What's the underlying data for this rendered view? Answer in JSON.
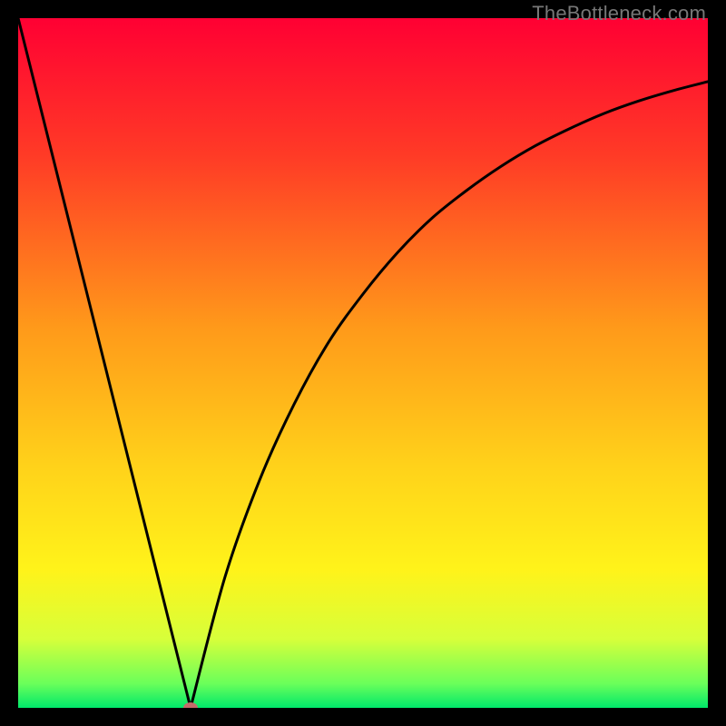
{
  "watermark": {
    "text": "TheBottleneck.com"
  },
  "chart_data": {
    "type": "line",
    "title": "",
    "xlabel": "",
    "ylabel": "",
    "xlim": [
      0,
      100
    ],
    "ylim": [
      0,
      100
    ],
    "grid": false,
    "background": "rainbow-gradient",
    "gradient_stops": [
      {
        "pos": 0.0,
        "color": "#ff0033"
      },
      {
        "pos": 0.2,
        "color": "#ff3b26"
      },
      {
        "pos": 0.45,
        "color": "#ff9a1a"
      },
      {
        "pos": 0.65,
        "color": "#ffd21a"
      },
      {
        "pos": 0.8,
        "color": "#fff31a"
      },
      {
        "pos": 0.9,
        "color": "#d7ff3a"
      },
      {
        "pos": 0.965,
        "color": "#6aff5a"
      },
      {
        "pos": 1.0,
        "color": "#00e86a"
      }
    ],
    "series": [
      {
        "name": "left-line",
        "x": [
          0,
          25
        ],
        "y": [
          100,
          0
        ]
      },
      {
        "name": "right-curve",
        "x": [
          25,
          30,
          35,
          40,
          45,
          50,
          55,
          60,
          65,
          70,
          75,
          80,
          85,
          90,
          95,
          100
        ],
        "y": [
          0,
          19,
          33,
          44,
          53,
          60,
          66,
          71,
          75,
          78.5,
          81.5,
          84,
          86.2,
          88,
          89.5,
          90.8
        ]
      }
    ],
    "marker": {
      "x": 25,
      "y": 0,
      "color": "#c56a6a",
      "rx": 8,
      "ry": 6
    }
  }
}
